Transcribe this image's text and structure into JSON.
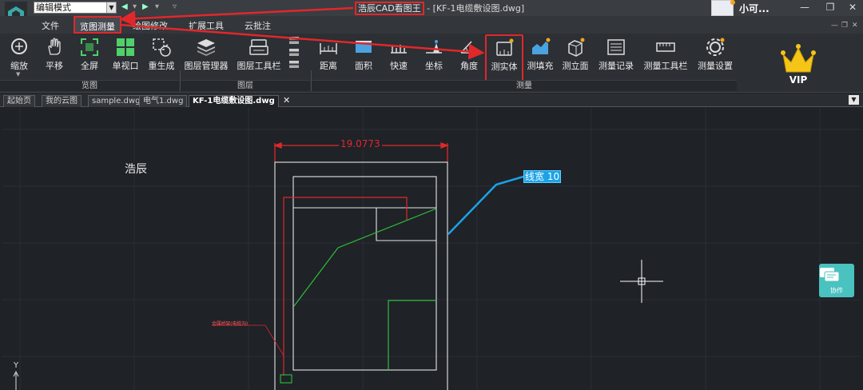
{
  "titlebar": {
    "mode_select": "编辑模式",
    "title_brand": "浩辰CAD看图王",
    "title_rest": " - [KF-1电缆敷设图.dwg]",
    "user_name": "小可..."
  },
  "menu": {
    "tabs": [
      "文件",
      "览图测量",
      "绘图修改",
      "扩展工具",
      "云批注"
    ],
    "active_index": 1
  },
  "ribbon": {
    "tools": [
      {
        "label": "缩放",
        "icon": "magnifier-icon"
      },
      {
        "label": "平移",
        "icon": "hand-pan-icon"
      },
      {
        "label": "全屏",
        "icon": "fullscreen-icon"
      },
      {
        "label": "单视口",
        "icon": "single-viewport-icon"
      },
      {
        "label": "重生成",
        "icon": "regenerate-icon"
      },
      {
        "label": "图层管理器",
        "icon": "layers-icon"
      },
      {
        "label": "图层工具栏",
        "icon": "layer-toolbar-icon"
      },
      {
        "label": "距离",
        "icon": "ruler-distance-icon"
      },
      {
        "label": "面积",
        "icon": "area-icon"
      },
      {
        "label": "快速",
        "icon": "quick-measure-icon"
      },
      {
        "label": "坐标",
        "icon": "coordinate-icon"
      },
      {
        "label": "角度",
        "icon": "angle-icon"
      },
      {
        "label": "测实体",
        "icon": "measure-entity-icon"
      },
      {
        "label": "测填充",
        "icon": "measure-hatch-icon"
      },
      {
        "label": "测立面",
        "icon": "measure-elevation-icon"
      },
      {
        "label": "测量记录",
        "icon": "measure-record-icon"
      },
      {
        "label": "测量工具栏",
        "icon": "measure-toolbar-icon"
      },
      {
        "label": "测量设置",
        "icon": "gear-icon"
      }
    ],
    "highlighted_tool": "测实体",
    "groups": [
      "览图",
      "图层",
      "测量"
    ],
    "vip_label": "VIP"
  },
  "doc_tabs": {
    "tabs": [
      "起始页",
      "我的云图",
      "sample.dwg",
      "电气1.dwg",
      "KF-1电缆敷设图.dwg"
    ],
    "active_index": 4
  },
  "canvas": {
    "label_main": "浩辰",
    "dimension_value": "19.0773",
    "leader_label": "线宽 10",
    "small_label": "金属桥架(电缆沟)",
    "axis_y": "Y",
    "collab_label": "协作"
  },
  "colors": {
    "highlight_red": "#e0282b",
    "leader_blue": "#1aa3e8",
    "entity_green": "#2fbf3a",
    "collab_teal": "#49c2c0",
    "vip_gold": "#f5c518"
  }
}
